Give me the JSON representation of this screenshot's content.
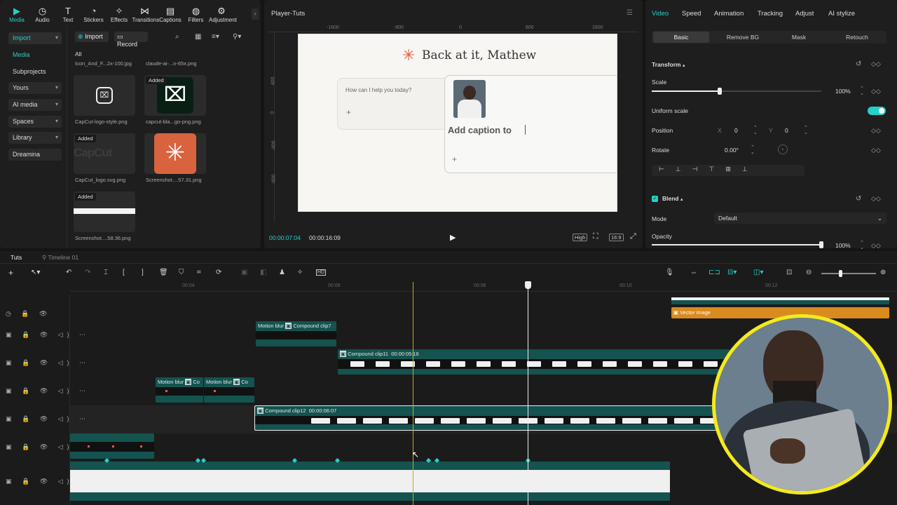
{
  "toolbar": {
    "items": [
      {
        "label": "Media",
        "icon": "media-icon"
      },
      {
        "label": "Audio",
        "icon": "audio-icon"
      },
      {
        "label": "Text",
        "icon": "text-icon"
      },
      {
        "label": "Stickers",
        "icon": "stickers-icon"
      },
      {
        "label": "Effects",
        "icon": "effects-icon"
      },
      {
        "label": "Transitions",
        "icon": "transitions-icon"
      },
      {
        "label": "Captions",
        "icon": "captions-icon"
      },
      {
        "label": "Filters",
        "icon": "filters-icon"
      },
      {
        "label": "Adjustment",
        "icon": "adjustment-icon"
      }
    ]
  },
  "sidebar": {
    "items": [
      {
        "label": "Import"
      },
      {
        "label": "Media"
      },
      {
        "label": "Subprojects"
      },
      {
        "label": "Yours"
      },
      {
        "label": "AI media"
      },
      {
        "label": "Spaces"
      },
      {
        "label": "Library"
      },
      {
        "label": "Dreamina"
      }
    ]
  },
  "media": {
    "import_label": "Import",
    "record_label": "Record",
    "filter_label": "All",
    "top_files": [
      "Icon_And_F...2x-100.jpg",
      "claude-ai-...n-65x.png"
    ],
    "items": [
      {
        "name": "CapCut-logo-style.png",
        "badge": ""
      },
      {
        "name": "capcut-bla...go-png.png",
        "badge": "Added"
      },
      {
        "name": "CapCut_logo.svg.png",
        "badge": "Added"
      },
      {
        "name": "Screenshot....57.31.png",
        "badge": ""
      },
      {
        "name": "Screenshot....58.36.png",
        "badge": "Added"
      }
    ],
    "logo_text": "CapCut"
  },
  "player": {
    "title": "Player-Tuts",
    "ruler": [
      "-1600",
      "-800",
      "0",
      "800",
      "1600"
    ],
    "vruler": [
      "400",
      "0",
      "-400",
      "-800"
    ],
    "heading": "Back at it, Mathew",
    "prompt": "How can I help you today?",
    "caption": "Add caption to",
    "time_current": "00:00:07:04",
    "time_total": "00:00:16:09",
    "quality": "High",
    "ratio": "16:9"
  },
  "props": {
    "tabs": [
      "Video",
      "Speed",
      "Animation",
      "Tracking",
      "Adjust",
      "AI stylize"
    ],
    "subtabs": [
      "Basic",
      "Remove BG",
      "Mask",
      "Retouch"
    ],
    "transform_label": "Transform",
    "scale_label": "Scale",
    "scale_value": "100%",
    "scale_level": 0.4,
    "uniform_label": "Uniform scale",
    "position_label": "Position",
    "pos_x_label": "X",
    "pos_x": "0",
    "pos_y_label": "Y",
    "pos_y": "0",
    "rotate_label": "Rotate",
    "rotate_value": "0.00°",
    "blend_label": "Blend",
    "mode_label": "Mode",
    "mode_value": "Default",
    "opacity_label": "Opacity",
    "opacity_value": "100%",
    "opacity_level": 1.0
  },
  "timeline": {
    "tab_main": "Tuts",
    "tab_other": "Timeline 01",
    "ruler": [
      "00:04",
      "00:06",
      "00:08",
      "00:10",
      "00:12"
    ],
    "clip_vector": "Vector image",
    "clip_motion": "Motion blur",
    "clip_compound7": "Compound clip7",
    "clip_compound11": "Compound clip11",
    "clip_compound11_dur": "00:00:05:16",
    "clip_compound12": "Compound clip12",
    "clip_compound12_dur": "00:00:06:07",
    "clip_co": "Co"
  },
  "colors": {
    "accent": "#25d0c8",
    "clip": "#14534f",
    "vector": "#d98b1e",
    "playhead": "#c8a630",
    "webcam_ring": "#f4ea1c"
  }
}
